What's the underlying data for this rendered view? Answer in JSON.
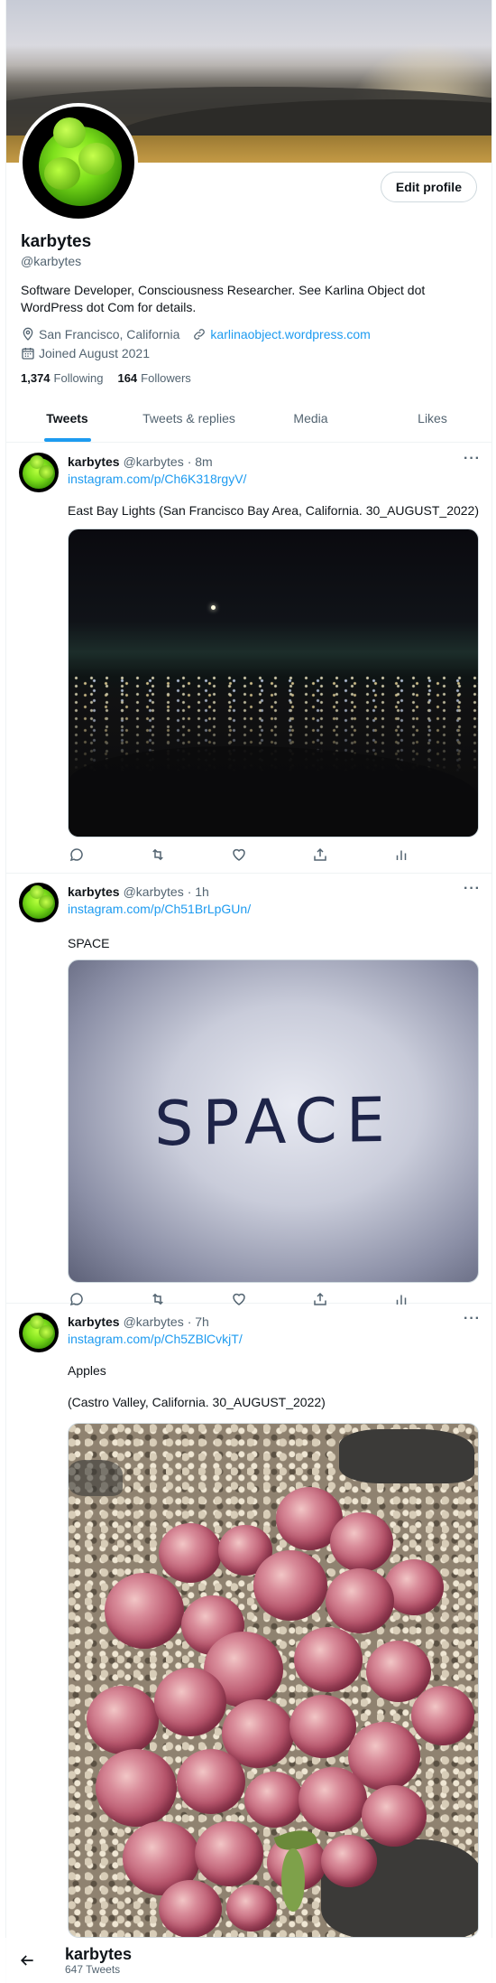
{
  "profile": {
    "name": "karbytes",
    "handle": "@karbytes",
    "bio": "Software Developer, Consciousness Researcher. See Karlina Object dot WordPress dot Com for details.",
    "location": "San Francisco, California",
    "website": "karlinaobject.wordpress.com",
    "joined": "Joined August 2021",
    "following_count": "1,374",
    "following_label": "Following",
    "followers_count": "164",
    "followers_label": "Followers",
    "edit_label": "Edit profile"
  },
  "tabs": [
    {
      "label": "Tweets",
      "active": true
    },
    {
      "label": "Tweets & replies",
      "active": false
    },
    {
      "label": "Media",
      "active": false
    },
    {
      "label": "Likes",
      "active": false
    }
  ],
  "tweets": [
    {
      "name": "karbytes",
      "handle": "@karbytes",
      "time": "· 8m",
      "link": "instagram.com/p/Ch6K318rgyV/",
      "text": "East Bay Lights (San Francisco Bay Area, California. 30_AUGUST_2022)"
    },
    {
      "name": "karbytes",
      "handle": "@karbytes",
      "time": "· 1h",
      "link": "instagram.com/p/Ch51BrLpGUn/",
      "text": "SPACE",
      "image_text": "SPACE"
    },
    {
      "name": "karbytes",
      "handle": "@karbytes",
      "time": "· 7h",
      "link": "instagram.com/p/Ch5ZBlCvkjT/",
      "text": "Apples",
      "text2": "(Castro Valley, California. 30_AUGUST_2022)"
    }
  ],
  "more_icon": "···",
  "icons": [
    "reply-icon",
    "retweet-icon",
    "like-icon",
    "share-icon",
    "analytics-icon"
  ],
  "header": {
    "title": "karbytes",
    "tweet_count": "647 Tweets"
  },
  "colors": {
    "accent": "#1d9bf0",
    "secondary_text": "#536471",
    "primary_text": "#0f1419"
  }
}
